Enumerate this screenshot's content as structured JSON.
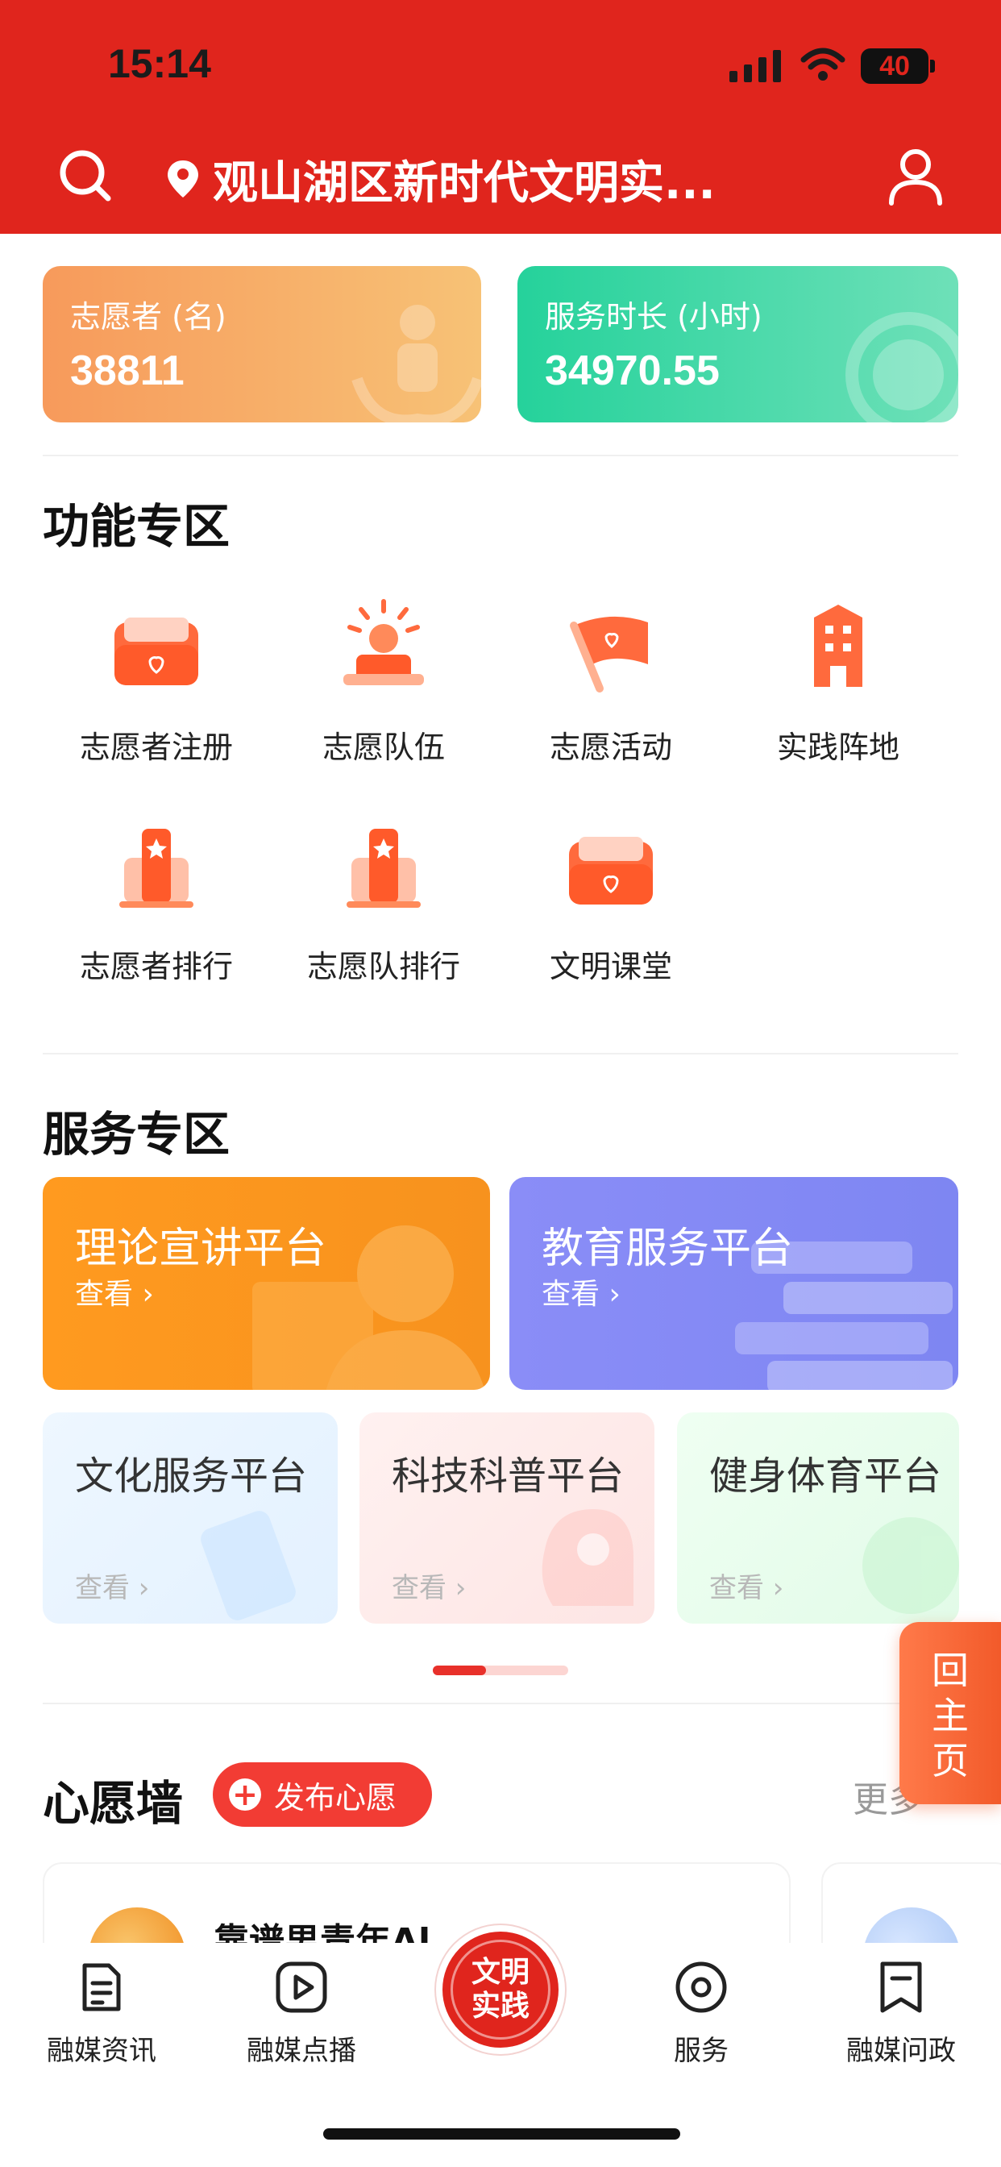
{
  "status_bar": {
    "time": "15:14",
    "battery": "40"
  },
  "header": {
    "location_title": "观山湖区新时代文明实..."
  },
  "stats": [
    {
      "label": "志愿者 (名)",
      "value": "38811"
    },
    {
      "label": "服务时长 (小时)",
      "value": "34970.55"
    }
  ],
  "functions": {
    "title": "功能专区",
    "items": [
      {
        "label": "志愿者注册",
        "icon": "register-icon"
      },
      {
        "label": "志愿队伍",
        "icon": "team-icon"
      },
      {
        "label": "志愿活动",
        "icon": "flag-icon"
      },
      {
        "label": "实践阵地",
        "icon": "building-icon"
      },
      {
        "label": "志愿者排行",
        "icon": "ranking-icon"
      },
      {
        "label": "志愿队排行",
        "icon": "ranking-icon"
      },
      {
        "label": "文明课堂",
        "icon": "classroom-icon"
      }
    ]
  },
  "services": {
    "title": "服务专区",
    "big_cards": [
      {
        "title": "理论宣讲平台",
        "view": "查看 ›"
      },
      {
        "title": "教育服务平台",
        "view": "查看 ›"
      }
    ],
    "small_cards": [
      {
        "title": "文化服务平台",
        "view": "查看 ›"
      },
      {
        "title": "科技科普平台",
        "view": "查看 ›"
      },
      {
        "title": "健身体育平台",
        "view": "查看 ›"
      }
    ]
  },
  "float_button": {
    "label": "回主页"
  },
  "wish_wall": {
    "title": "心愿墙",
    "publish_label": "发布心愿",
    "more_label": "更多",
    "cards": [
      {
        "name": "靠谱男青年Al"
      }
    ]
  },
  "bottom_nav": {
    "items": [
      {
        "label": "融媒资讯",
        "icon": "news-icon"
      },
      {
        "label": "融媒点播",
        "icon": "play-icon"
      },
      {
        "label": "服务",
        "icon": "service-icon"
      },
      {
        "label": "融媒问政",
        "icon": "bookmark-icon"
      }
    ],
    "center_label_1": "文明",
    "center_label_2": "实践"
  },
  "colors": {
    "brand_red": "#e0251d",
    "orange": "#ff9a1f",
    "purple": "#8a8df7",
    "green": "#25d29b"
  }
}
